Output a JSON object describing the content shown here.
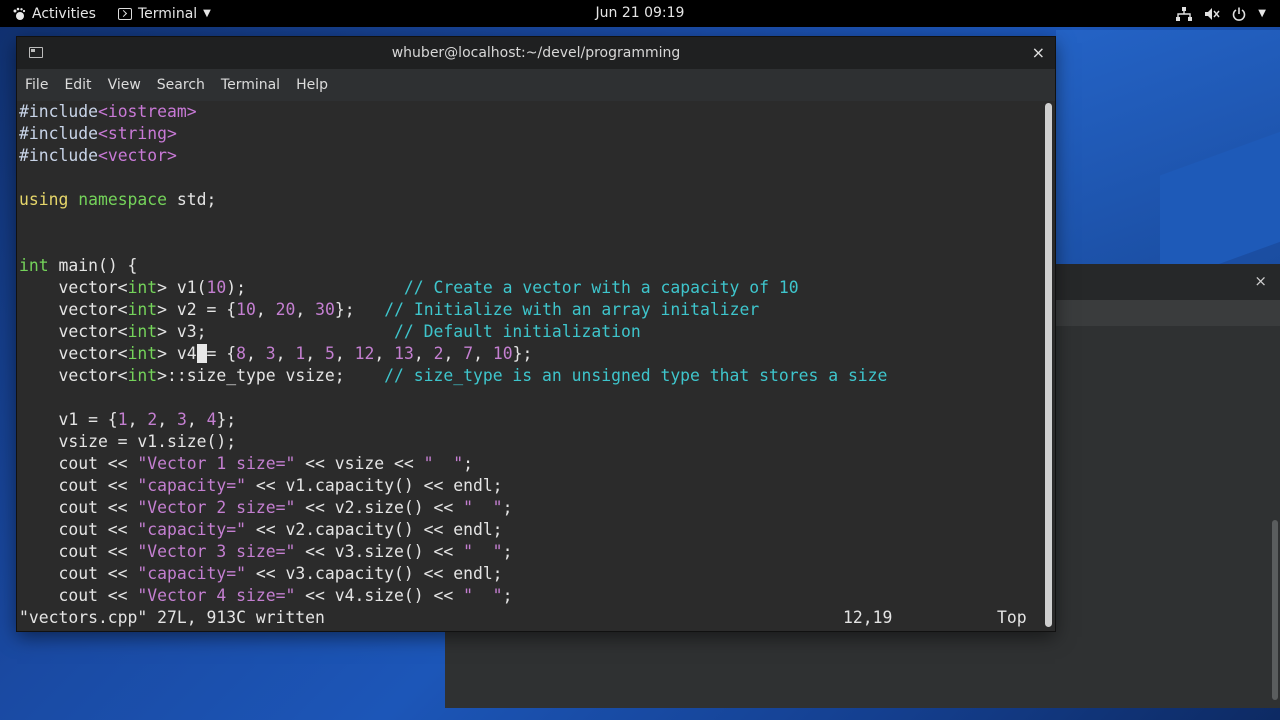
{
  "topbar": {
    "activities": "Activities",
    "app_name": "Terminal",
    "clock": "Jun 21  09:19"
  },
  "window": {
    "title": "whuber@localhost:~/devel/programming",
    "close": "×"
  },
  "menu": [
    "File",
    "Edit",
    "View",
    "Search",
    "Terminal",
    "Help"
  ],
  "code": {
    "l1a": "#include",
    "l1b": "<iostream>",
    "l2a": "#include",
    "l2b": "<string>",
    "l3a": "#include",
    "l3b": "<vector>",
    "l5a": "using",
    "l5b": " ",
    "l5c": "namespace",
    "l5d": " std;",
    "l8a": "int",
    "l8b": " main() {",
    "l9a": "    vector<",
    "l9b": "int",
    "l9c": "> v1(",
    "l9d": "10",
    "l9e": ");",
    "l9f": "                // Create a vector with a capacity of 10",
    "l10a": "    vector<",
    "l10b": "int",
    "l10c": "> v2 = {",
    "l10d": "10",
    "l10e": ", ",
    "l10f": "20",
    "l10g": ", ",
    "l10h": "30",
    "l10i": "};",
    "l10j": "   // Initialize with an array initalizer",
    "l11a": "    vector<",
    "l11b": "int",
    "l11c": "> v3;",
    "l11d": "                   // Default initialization",
    "l12a": "    vector<",
    "l12b": "int",
    "l12c": "> v4",
    "l12cur": " ",
    "l12d": "= {",
    "l12n1": "8",
    "l12s1": ", ",
    "l12n2": "3",
    "l12s2": ", ",
    "l12n3": "1",
    "l12s3": ", ",
    "l12n4": "5",
    "l12s4": ", ",
    "l12n5": "12",
    "l12s5": ", ",
    "l12n6": "13",
    "l12s6": ", ",
    "l12n7": "2",
    "l12s7": ", ",
    "l12n8": "7",
    "l12s8": ", ",
    "l12n9": "10",
    "l12e": "};",
    "l13a": "    vector<",
    "l13b": "int",
    "l13c": ">::size_type vsize;",
    "l13d": "    // size_type is an unsigned type that stores a size",
    "l15a": "    v1 = {",
    "l15b": "1",
    "l15c": ", ",
    "l15d": "2",
    "l15e": ", ",
    "l15f": "3",
    "l15g": ", ",
    "l15h": "4",
    "l15i": "};",
    "l16": "    vsize = v1.size();",
    "l17a": "    cout << ",
    "l17b": "\"Vector 1 size=\"",
    "l17c": " << vsize << ",
    "l17d": "\"  \"",
    "l17e": ";",
    "l18a": "    cout << ",
    "l18b": "\"capacity=\"",
    "l18c": " << v1.capacity() << endl;",
    "l19a": "    cout << ",
    "l19b": "\"Vector 2 size=\"",
    "l19c": " << v2.size() << ",
    "l19d": "\"  \"",
    "l19e": ";",
    "l20a": "    cout << ",
    "l20b": "\"capacity=\"",
    "l20c": " << v2.capacity() << endl;",
    "l21a": "    cout << ",
    "l21b": "\"Vector 3 size=\"",
    "l21c": " << v3.size() << ",
    "l21d": "\"  \"",
    "l21e": ";",
    "l22a": "    cout << ",
    "l22b": "\"capacity=\"",
    "l22c": " << v3.capacity() << endl;",
    "l23a": "    cout << ",
    "l23b": "\"Vector 4 size=\"",
    "l23c": " << v4.size() << ",
    "l23d": "\"  \"",
    "l23e": ";"
  },
  "status": {
    "message": "\"vectors.cpp\" 27L, 913C written",
    "position": "12,19",
    "scroll": "Top"
  },
  "bg_window": {
    "close": "×"
  }
}
